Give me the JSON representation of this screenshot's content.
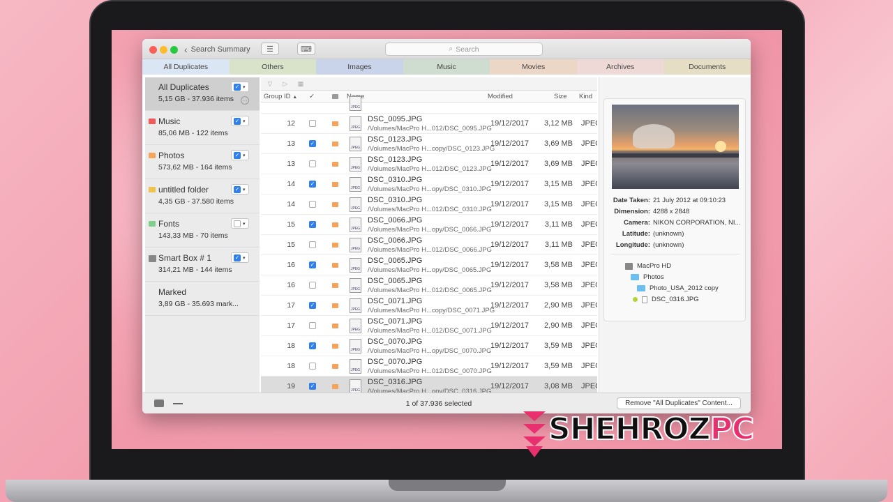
{
  "titlebar": {
    "back_label": "Search Summary",
    "search_placeholder": "Search"
  },
  "tabs": [
    {
      "label": "All Duplicates",
      "color": "#dbe6f4"
    },
    {
      "label": "Others",
      "color": "#d8e3c9"
    },
    {
      "label": "Images",
      "color": "#c9d3ea"
    },
    {
      "label": "Music",
      "color": "#cfdcd0"
    },
    {
      "label": "Movies",
      "color": "#ecd6c6"
    },
    {
      "label": "Archives",
      "color": "#efd9d6"
    },
    {
      "label": "Documents",
      "color": "#e5ddc4"
    }
  ],
  "sidebar": {
    "items": [
      {
        "title": "All Duplicates",
        "sub": "5,15 GB - 37.936 items",
        "checked": true,
        "selected": true,
        "icon": "none"
      },
      {
        "title": "Music",
        "sub": "85,06 MB - 122 items",
        "checked": true,
        "icon": "folder-red"
      },
      {
        "title": "Photos",
        "sub": "573,62 MB - 164 items",
        "checked": true,
        "icon": "folder-orange"
      },
      {
        "title": "untitled folder",
        "sub": "4,35 GB - 37.580 items",
        "checked": true,
        "icon": "folder-yellow"
      },
      {
        "title": "Fonts",
        "sub": "143,33 MB - 70 items",
        "checked": false,
        "icon": "folder-green"
      },
      {
        "title": "Smart Box # 1",
        "sub": "314,21 MB - 144 items",
        "checked": true,
        "icon": "smart-box"
      },
      {
        "title": "Marked",
        "sub": "3,89 GB - 35.693 mark...",
        "icon": "none"
      }
    ]
  },
  "columns": {
    "group_id": "Group ID",
    "name": "Name",
    "modified": "Modified",
    "size": "Size",
    "kind": "Kind"
  },
  "rows": [
    {
      "gid": "12",
      "checked": false,
      "name": "DSC_0095.JPG",
      "path": "/Volumes/MacPro H...012/DSC_0095.JPG",
      "modified": "19/12/2017",
      "size": "3,12 MB",
      "kind": "JPEG"
    },
    {
      "gid": "13",
      "checked": true,
      "name": "DSC_0123.JPG",
      "path": "/Volumes/MacPro H...copy/DSC_0123.JPG",
      "modified": "19/12/2017",
      "size": "3,69 MB",
      "kind": "JPEG"
    },
    {
      "gid": "13",
      "checked": false,
      "name": "DSC_0123.JPG",
      "path": "/Volumes/MacPro H...012/DSC_0123.JPG",
      "modified": "19/12/2017",
      "size": "3,69 MB",
      "kind": "JPEG"
    },
    {
      "gid": "14",
      "checked": true,
      "name": "DSC_0310.JPG",
      "path": "/Volumes/MacPro H...opy/DSC_0310.JPG",
      "modified": "19/12/2017",
      "size": "3,15 MB",
      "kind": "JPEG"
    },
    {
      "gid": "14",
      "checked": false,
      "name": "DSC_0310.JPG",
      "path": "/Volumes/MacPro H...012/DSC_0310.JPG",
      "modified": "19/12/2017",
      "size": "3,15 MB",
      "kind": "JPEG"
    },
    {
      "gid": "15",
      "checked": true,
      "name": "DSC_0066.JPG",
      "path": "/Volumes/MacPro H...opy/DSC_0066.JPG",
      "modified": "19/12/2017",
      "size": "3,11 MB",
      "kind": "JPEG"
    },
    {
      "gid": "15",
      "checked": false,
      "name": "DSC_0066.JPG",
      "path": "/Volumes/MacPro H...012/DSC_0066.JPG",
      "modified": "19/12/2017",
      "size": "3,11 MB",
      "kind": "JPEG"
    },
    {
      "gid": "16",
      "checked": true,
      "name": "DSC_0065.JPG",
      "path": "/Volumes/MacPro H...opy/DSC_0065.JPG",
      "modified": "19/12/2017",
      "size": "3,58 MB",
      "kind": "JPEG"
    },
    {
      "gid": "16",
      "checked": false,
      "name": "DSC_0065.JPG",
      "path": "/Volumes/MacPro H...012/DSC_0065.JPG",
      "modified": "19/12/2017",
      "size": "3,58 MB",
      "kind": "JPEG"
    },
    {
      "gid": "17",
      "checked": true,
      "name": "DSC_0071.JPG",
      "path": "/Volumes/MacPro H...copy/DSC_0071.JPG",
      "modified": "19/12/2017",
      "size": "2,90 MB",
      "kind": "JPEG"
    },
    {
      "gid": "17",
      "checked": false,
      "name": "DSC_0071.JPG",
      "path": "/Volumes/MacPro H...012/DSC_0071.JPG",
      "modified": "19/12/2017",
      "size": "2,90 MB",
      "kind": "JPEG"
    },
    {
      "gid": "18",
      "checked": true,
      "name": "DSC_0070.JPG",
      "path": "/Volumes/MacPro H...opy/DSC_0070.JPG",
      "modified": "19/12/2017",
      "size": "3,59 MB",
      "kind": "JPEG"
    },
    {
      "gid": "18",
      "checked": false,
      "name": "DSC_0070.JPG",
      "path": "/Volumes/MacPro H...012/DSC_0070.JPG",
      "modified": "19/12/2017",
      "size": "3,59 MB",
      "kind": "JPEG"
    },
    {
      "gid": "19",
      "checked": true,
      "selected": true,
      "name": "DSC_0316.JPG",
      "path": "/Volumes/MacPro H...opy/DSC_0316.JPG",
      "modified": "19/12/2017",
      "size": "3,08 MB",
      "kind": "JPEG"
    }
  ],
  "info": {
    "fields": [
      {
        "label": "Date Taken:",
        "value": "21 July 2012 at 09:10:23"
      },
      {
        "label": "Dimension:",
        "value": "4288 x 2848"
      },
      {
        "label": "Camera:",
        "value": "NIKON CORPORATION, NI..."
      },
      {
        "label": "Latitude:",
        "value": "(unknown)"
      },
      {
        "label": "Longitude:",
        "value": "(unknown)"
      }
    ],
    "path": {
      "drive": "MacPro HD",
      "folder1": "Photos",
      "folder2": "Photo_USA_2012 copy",
      "file": "DSC_0316.JPG"
    }
  },
  "footer": {
    "status": "1 of 37.936 selected",
    "remove_label": "Remove \"All Duplicates\" Content..."
  },
  "watermark": {
    "text": "SHEHROZPC",
    "part1": "SHEHROZ",
    "part2": "PC"
  },
  "colors": {
    "accent": "#2f7ff0",
    "watermark_pink": "#e8306e"
  }
}
